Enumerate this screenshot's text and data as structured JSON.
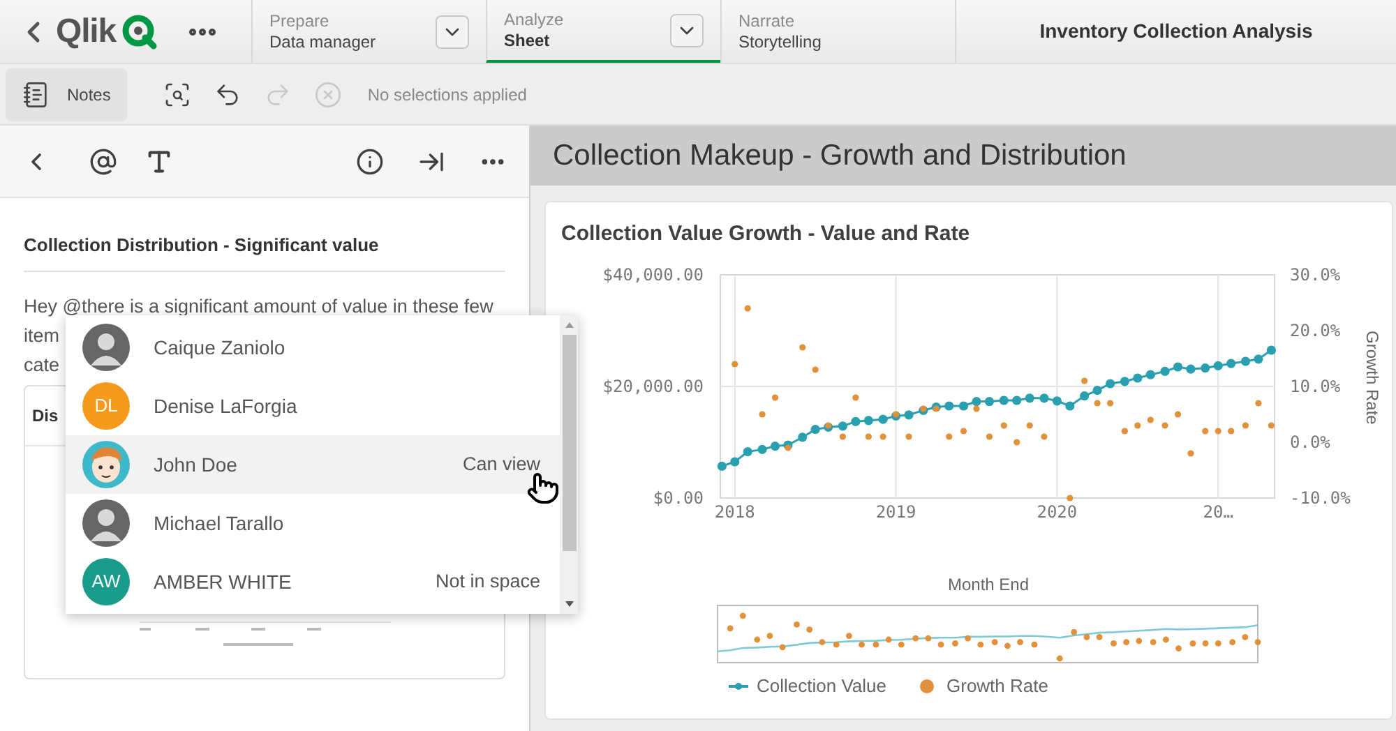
{
  "app_bar": {
    "logo": "Qlik",
    "tabs": [
      {
        "label": "Prepare",
        "value": "Data manager",
        "selected": false,
        "has_menu": true
      },
      {
        "label": "Analyze",
        "value": "Sheet",
        "selected": true,
        "has_menu": true
      },
      {
        "label": "Narrate",
        "value": "Storytelling",
        "selected": false,
        "has_menu": false
      }
    ],
    "app_title": "Inventory Collection Analysis"
  },
  "toolbar": {
    "notes_button": "Notes",
    "tools": [
      {
        "kind": "smart-search",
        "disabled": false
      },
      {
        "kind": "step-back",
        "disabled": false
      },
      {
        "kind": "step-forward",
        "disabled": true
      },
      {
        "kind": "clear",
        "disabled": true
      }
    ],
    "selections": "No selections applied"
  },
  "note": {
    "title": "Collection Distribution - Significant value",
    "lines": [
      "Hey @there is a significant amount of value in these few",
      "item",
      "cate"
    ],
    "card_title": "Dis"
  },
  "mentions": [
    {
      "name": "Caique Zaniolo",
      "kind": "photo",
      "selected": false
    },
    {
      "name": "Denise LaForgia",
      "kind": "initials",
      "initials": "DL",
      "color": "#f59a1d",
      "selected": false
    },
    {
      "name": "John Doe",
      "status": "Can view",
      "kind": "cartoon",
      "selected": true
    },
    {
      "name": "Michael Tarallo",
      "kind": "photo",
      "selected": false
    },
    {
      "name": "AMBER WHITE",
      "status": "Not in space",
      "kind": "initials",
      "initials": "AW",
      "color": "#1a9c8c",
      "selected": false
    }
  ],
  "sheet": {
    "title": "Collection Makeup - Growth and Distribution",
    "chart_data": {
      "type": "line",
      "title": "Collection Value Growth - Value and Rate",
      "xlabel": "Month End",
      "y2label": "Growth Rate",
      "x": [
        2017.92,
        2018.0,
        2018.08,
        2018.17,
        2018.25,
        2018.33,
        2018.42,
        2018.5,
        2018.58,
        2018.67,
        2018.75,
        2018.83,
        2018.92,
        2019.0,
        2019.08,
        2019.17,
        2019.25,
        2019.33,
        2019.42,
        2019.5,
        2019.58,
        2019.67,
        2019.75,
        2019.83,
        2019.92,
        2020.0,
        2020.08,
        2020.17,
        2020.25,
        2020.33,
        2020.42,
        2020.5,
        2020.58,
        2020.67,
        2020.75,
        2020.83,
        2020.92,
        2021.0,
        2021.08,
        2021.17,
        2021.25,
        2021.33
      ],
      "series": [
        {
          "name": "Collection Value",
          "color": "#2a9fb0",
          "marker": "circle",
          "values": [
            5700,
            6500,
            8300,
            8700,
            9300,
            9500,
            10900,
            12300,
            12700,
            12900,
            13700,
            13900,
            14100,
            14700,
            14900,
            15700,
            16300,
            16500,
            16500,
            17300,
            17300,
            17500,
            17500,
            17900,
            17900,
            17400,
            16500,
            18300,
            19300,
            20500,
            20900,
            21500,
            22100,
            22700,
            23500,
            23100,
            23300,
            23700,
            24100,
            24500,
            24900,
            26500
          ]
        },
        {
          "name": "Growth Rate",
          "color": "#e0913a",
          "axis": "y2",
          "type": "scatter",
          "values": [
            null,
            14,
            24,
            5,
            8,
            -1,
            17,
            13,
            3,
            1,
            8,
            1,
            1,
            5,
            1,
            6,
            6,
            1,
            2,
            6,
            1,
            3,
            0,
            3,
            1,
            null,
            -10,
            11,
            7,
            7,
            2,
            3,
            4,
            3,
            5,
            -2,
            2,
            2,
            2,
            3,
            7,
            3
          ]
        }
      ],
      "grid": true,
      "legend": true,
      "xlim": [
        2017.91,
        2021.35
      ],
      "ylim": [
        0,
        40000
      ],
      "y2lim": [
        -10,
        30
      ],
      "xticks": [
        2018,
        2019,
        2020,
        {
          "value": 2021,
          "label": "20…"
        }
      ],
      "yticks": [
        {
          "value": 0,
          "label": "$0.00"
        },
        {
          "value": 20000,
          "label": "$20,000.00"
        },
        {
          "value": 40000,
          "label": "$40,000.00"
        }
      ],
      "y2ticks": [
        {
          "value": -10,
          "label": "-10.0%"
        },
        {
          "value": 0,
          "label": "0.0%"
        },
        {
          "value": 10,
          "label": "10.0%"
        },
        {
          "value": 20,
          "label": "20.0%"
        },
        {
          "value": 30,
          "label": "30.0%"
        }
      ]
    }
  }
}
